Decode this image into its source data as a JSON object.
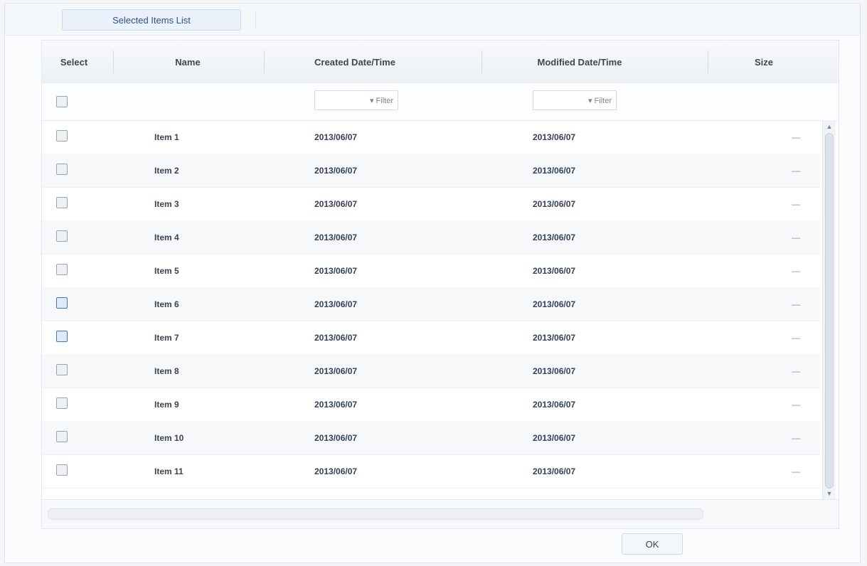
{
  "tabs": [
    {
      "label": "Selected Items List"
    }
  ],
  "columns": {
    "select": "Select",
    "name": "Name",
    "date1": "Created Date/Time",
    "date2": "Modified Date/Time",
    "status": "Size"
  },
  "filters": {
    "date1": "▾ Filter",
    "date2": "▾ Filter"
  },
  "rows": [
    {
      "name": "Item 1",
      "date1": "2013/06/07",
      "date2": "2013/06/07",
      "status": "—",
      "checked": false
    },
    {
      "name": "Item 2",
      "date1": "2013/06/07",
      "date2": "2013/06/07",
      "status": "—",
      "checked": false
    },
    {
      "name": "Item 3",
      "date1": "2013/06/07",
      "date2": "2013/06/07",
      "status": "—",
      "checked": false
    },
    {
      "name": "Item 4",
      "date1": "2013/06/07",
      "date2": "2013/06/07",
      "status": "—",
      "checked": false
    },
    {
      "name": "Item 5",
      "date1": "2013/06/07",
      "date2": "2013/06/07",
      "status": "—",
      "checked": false
    },
    {
      "name": "Item 6",
      "date1": "2013/06/07",
      "date2": "2013/06/07",
      "status": "—",
      "checked": true
    },
    {
      "name": "Item 7",
      "date1": "2013/06/07",
      "date2": "2013/06/07",
      "status": "—",
      "checked": true
    },
    {
      "name": "Item 8",
      "date1": "2013/06/07",
      "date2": "2013/06/07",
      "status": "—",
      "checked": false
    },
    {
      "name": "Item 9",
      "date1": "2013/06/07",
      "date2": "2013/06/07",
      "status": "—",
      "checked": false
    },
    {
      "name": "Item 10",
      "date1": "2013/06/07",
      "date2": "2013/06/07",
      "status": "—",
      "checked": false
    },
    {
      "name": "Item 11",
      "date1": "2013/06/07",
      "date2": "2013/06/07",
      "status": "—",
      "checked": false
    }
  ],
  "footer": {
    "ok_label": "OK"
  },
  "icons": {
    "scroll_up": "chevron-up-icon",
    "scroll_down": "chevron-down-icon"
  }
}
